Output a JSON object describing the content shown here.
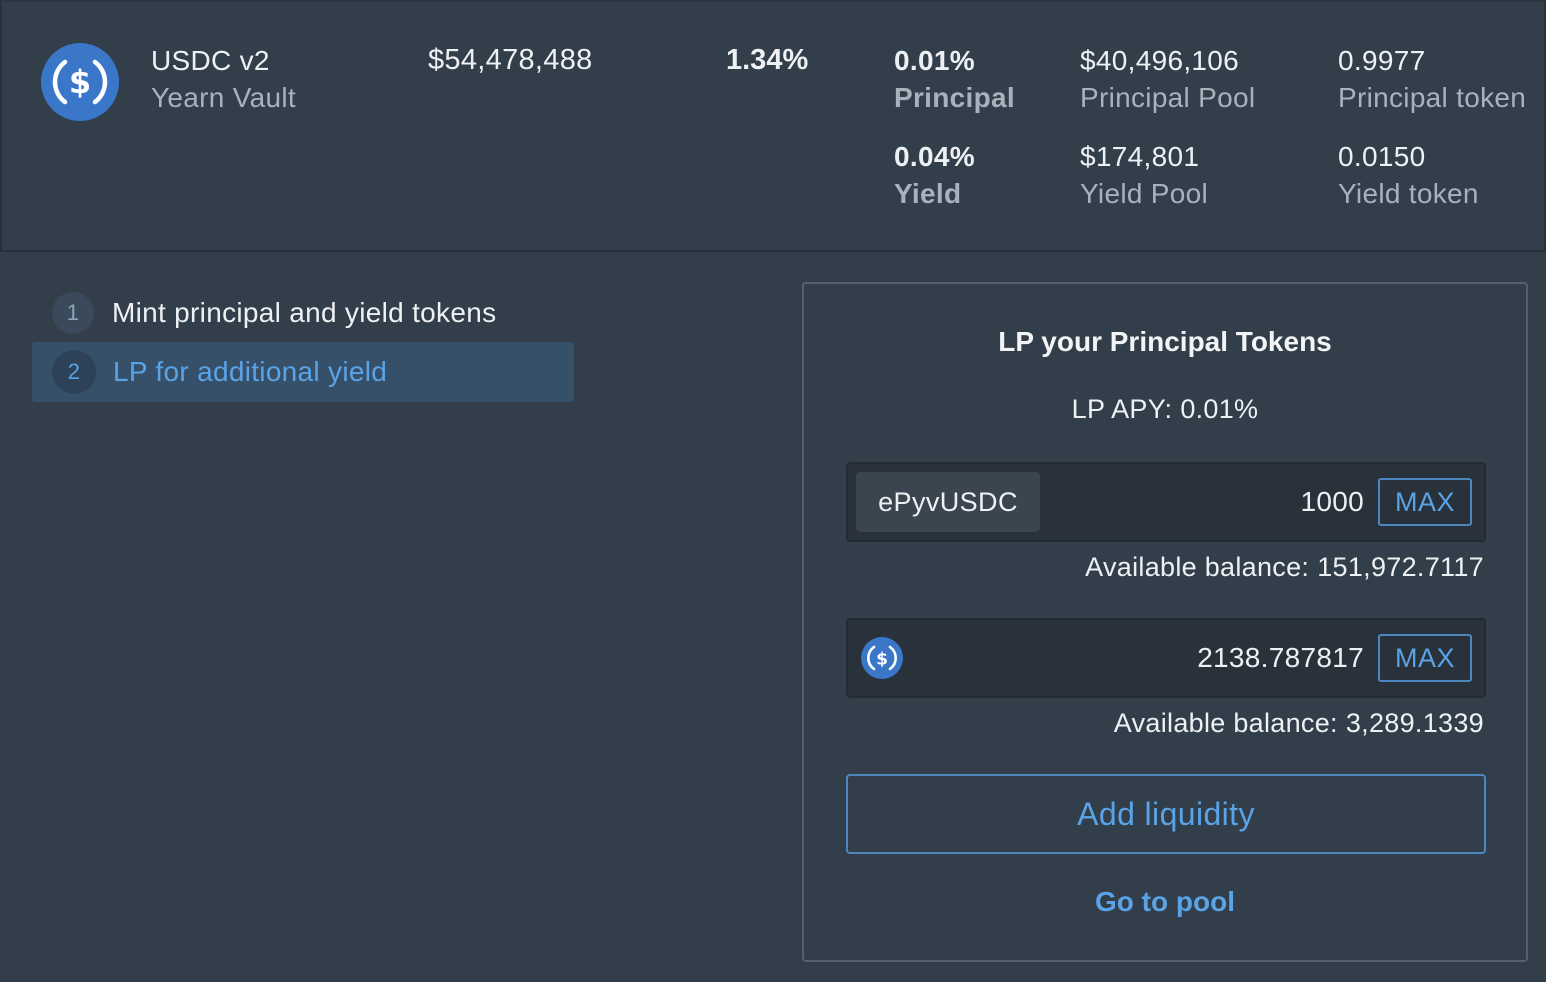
{
  "vault": {
    "name": "USDC v2",
    "subtitle": "Yearn Vault",
    "tvl": "$54,478,488",
    "apy": "1.34%",
    "icon": "usdc-icon"
  },
  "stats": {
    "principal": {
      "apy": "0.01%",
      "apy_label": "Principal",
      "pool_value": "$40,496,106",
      "pool_label": "Principal Pool",
      "token_price": "0.9977",
      "token_label": "Principal token"
    },
    "yield": {
      "apy": "0.04%",
      "apy_label": "Yield",
      "pool_value": "$174,801",
      "pool_label": "Yield Pool",
      "token_price": "0.0150",
      "token_label": "Yield token"
    }
  },
  "steps": [
    {
      "number": "1",
      "label": "Mint principal and yield tokens",
      "active": false
    },
    {
      "number": "2",
      "label": "LP for additional yield",
      "active": true
    }
  ],
  "card": {
    "title": "LP your Principal Tokens",
    "apy_label": "LP APY:",
    "apy_value": "0.01%",
    "inputs": [
      {
        "token": "ePyvUSDC",
        "amount": "1000",
        "max_label": "MAX",
        "balance_label": "Available balance:",
        "balance_value": "151,972.7117"
      },
      {
        "token_icon": "usdc-icon",
        "amount": "2138.787817",
        "max_label": "MAX",
        "balance_label": "Available balance:",
        "balance_value": "3,289.1339"
      }
    ],
    "add_liquidity_label": "Add liquidity",
    "go_to_pool_label": "Go to pool"
  },
  "colors": {
    "background": "#323e4a",
    "accent": "#5aa3e6",
    "usdc_blue": "#2775ca",
    "input_bg": "#29323b"
  }
}
